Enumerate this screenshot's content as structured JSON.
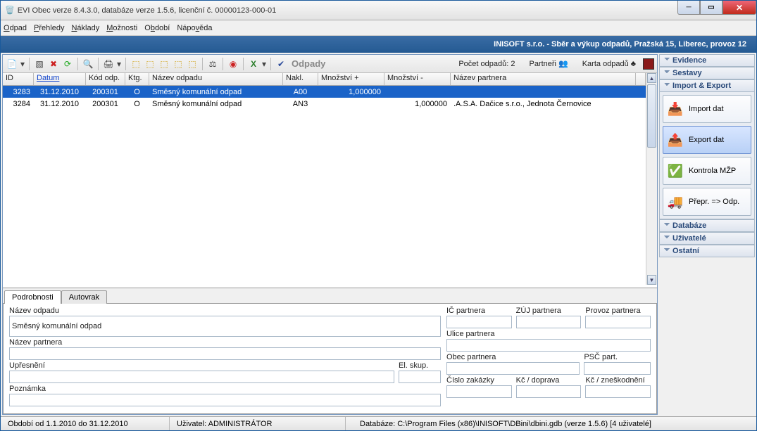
{
  "window": {
    "title": "EVI Obec verze 8.4.3.0, databáze verze 1.5.6, licenční č. 00000123-000-01"
  },
  "menu": {
    "odpad": "Odpad",
    "prehledy": "Přehledy",
    "naklady": "Náklady",
    "moznosti": "Možnosti",
    "obdobi": "Období",
    "napoveda": "Nápověda"
  },
  "context": "INISOFT s.r.o. - Sběr a výkup odpadů, Pražská 15, Liberec, provoz 12",
  "toolbar": {
    "label": "Odpady",
    "count_label": "Počet odpadů:",
    "count_value": "2",
    "partneri": "Partneři",
    "karta": "Karta odpadů"
  },
  "columns": {
    "id": "ID",
    "datum": "Datum",
    "kod": "Kód odp.",
    "ktg": "Ktg.",
    "nazev": "Název odpadu",
    "nakl": "Nakl.",
    "mplus": "Množství +",
    "mminus": "Množství -",
    "partner": "Název partnera"
  },
  "rows": [
    {
      "id": "3283",
      "datum": "31.12.2010",
      "kod": "200301",
      "ktg": "O",
      "nazev": "Směsný komunální odpad",
      "nakl": "A00",
      "mplus": "1,000000",
      "mminus": "",
      "partner": ""
    },
    {
      "id": "3284",
      "datum": "31.12.2010",
      "kod": "200301",
      "ktg": "O",
      "nazev": "Směsný komunální odpad",
      "nakl": "AN3",
      "mplus": "",
      "mminus": "1,000000",
      "partner": ".A.S.A. Dačice s.r.o., Jednota Černovice"
    }
  ],
  "tabs": {
    "pod": "Podrobnosti",
    "auto": "Autovrak"
  },
  "details": {
    "nazev_odpadu_lbl": "Název odpadu",
    "nazev_odpadu_val": "Směsný komunální odpad",
    "nazev_partnera_lbl": "Název partnera",
    "upresneni_lbl": "Upřesnění",
    "poznamka_lbl": "Poznámka",
    "el_skup_lbl": "El. skup.",
    "ic_partnera_lbl": "IČ partnera",
    "zuj_partnera_lbl": "ZÚJ partnera",
    "provoz_partnera_lbl": "Provoz partnera",
    "ulice_partnera_lbl": "Ulice partnera",
    "obec_partnera_lbl": "Obec partnera",
    "psc_part_lbl": "PSČ part.",
    "cislo_zakazky_lbl": "Číslo zakázky",
    "kc_doprava_lbl": "Kč / doprava",
    "kc_zneskodneni_lbl": "Kč / zneškodnění"
  },
  "side": {
    "evidence": "Evidence",
    "sestavy": "Sestavy",
    "import_export": "Import & Export",
    "import_dat": "Import dat",
    "export_dat": "Export dat",
    "kontrola": "Kontrola MŽP",
    "prepr": "Přepr. => Odp.",
    "databaze": "Databáze",
    "uzivatele": "Uživatelé",
    "ostatni": "Ostatní"
  },
  "status": {
    "obdobi": "Období od 1.1.2010 do 31.12.2010",
    "uzivatel": "Uživatel: ADMINISTRÁTOR",
    "db": "Databáze: C:\\Program Files (x86)\\INISOFT\\DBini\\dbini.gdb   (verze 1.5.6) [4 uživatelé]"
  }
}
